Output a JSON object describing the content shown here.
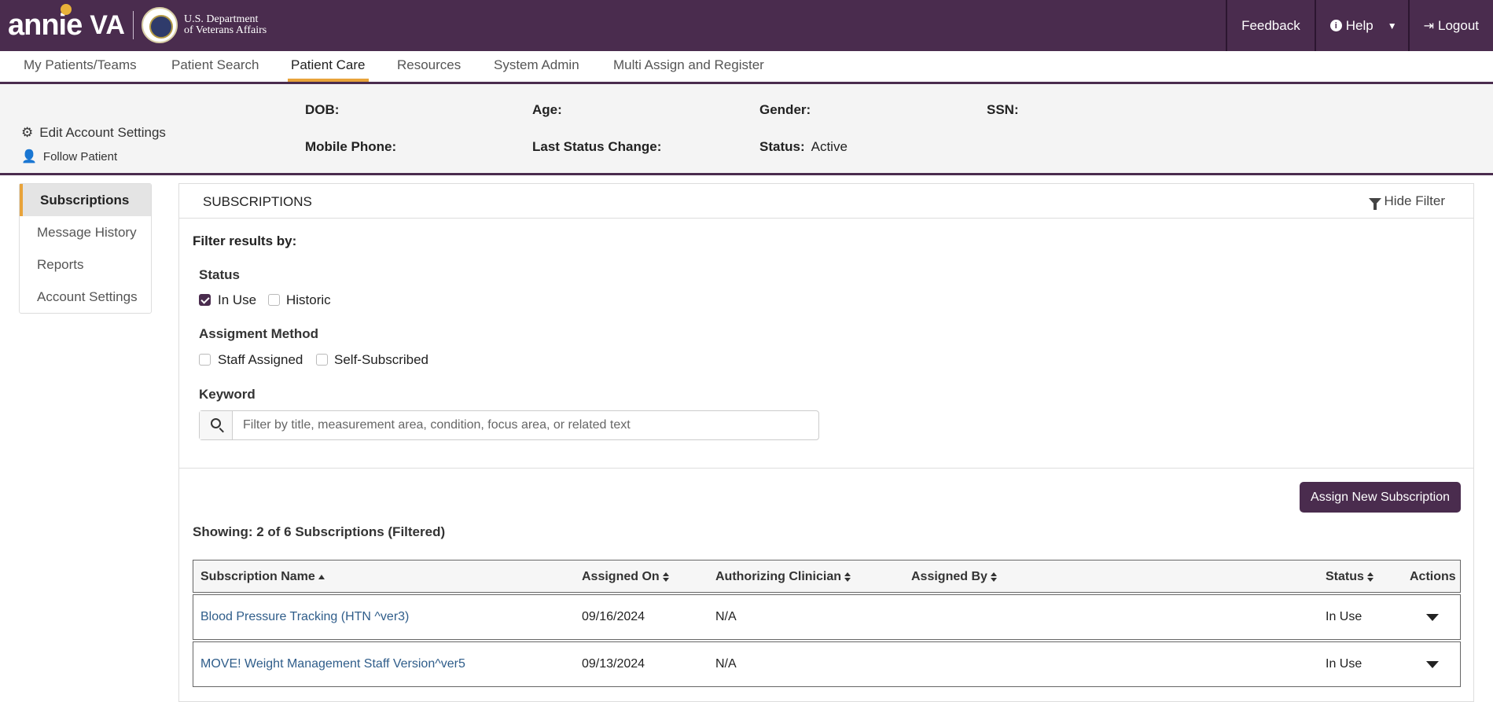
{
  "header": {
    "brand_annie": "annie",
    "brand_va": "VA",
    "dept_line1": "U.S. Department",
    "dept_line2": "of Veterans Affairs",
    "feedback": "Feedback",
    "help": "Help",
    "logout": "Logout"
  },
  "nav": {
    "items": [
      "My Patients/Teams",
      "Patient Search",
      "Patient Care",
      "Resources",
      "System Admin",
      "Multi Assign and Register"
    ],
    "active": "Patient Care"
  },
  "patient": {
    "edit_settings": "Edit Account Settings",
    "follow": "Follow Patient",
    "dob_label": "DOB:",
    "age_label": "Age:",
    "gender_label": "Gender:",
    "ssn_label": "SSN:",
    "mobile_label": "Mobile Phone:",
    "last_status_label": "Last Status Change:",
    "status_label": "Status:",
    "status_value": "Active"
  },
  "sidebar": {
    "items": [
      "Subscriptions",
      "Message History",
      "Reports",
      "Account Settings"
    ],
    "active": "Subscriptions"
  },
  "panel": {
    "title": "SUBSCRIPTIONS",
    "hide_filter": "Hide Filter",
    "filter_heading": "Filter results by:",
    "status_heading": "Status",
    "status_options": [
      {
        "label": "In Use",
        "checked": true
      },
      {
        "label": "Historic",
        "checked": false
      }
    ],
    "method_heading": "Assigment Method",
    "method_options": [
      {
        "label": "Staff Assigned",
        "checked": false
      },
      {
        "label": "Self-Subscribed",
        "checked": false
      }
    ],
    "keyword_heading": "Keyword",
    "keyword_placeholder": "Filter by title, measurement area, condition, focus area, or related text",
    "assign_button": "Assign New Subscription",
    "showing": "Showing: 2 of 6 Subscriptions (Filtered)"
  },
  "table": {
    "columns": [
      "Subscription Name",
      "Assigned On",
      "Authorizing Clinician",
      "Assigned By",
      "Status",
      "Actions"
    ],
    "rows": [
      {
        "name": "Blood Pressure Tracking (HTN ^ver3)",
        "assigned_on": "09/16/2024",
        "clinician": "N/A",
        "assigned_by": "",
        "status": "In Use"
      },
      {
        "name": "MOVE! Weight Management Staff Version^ver5",
        "assigned_on": "09/13/2024",
        "clinician": "N/A",
        "assigned_by": "",
        "status": "In Use"
      }
    ]
  },
  "colors": {
    "brand": "#4a2c4e",
    "accent": "#e8a33a",
    "link": "#2f5d8a"
  }
}
